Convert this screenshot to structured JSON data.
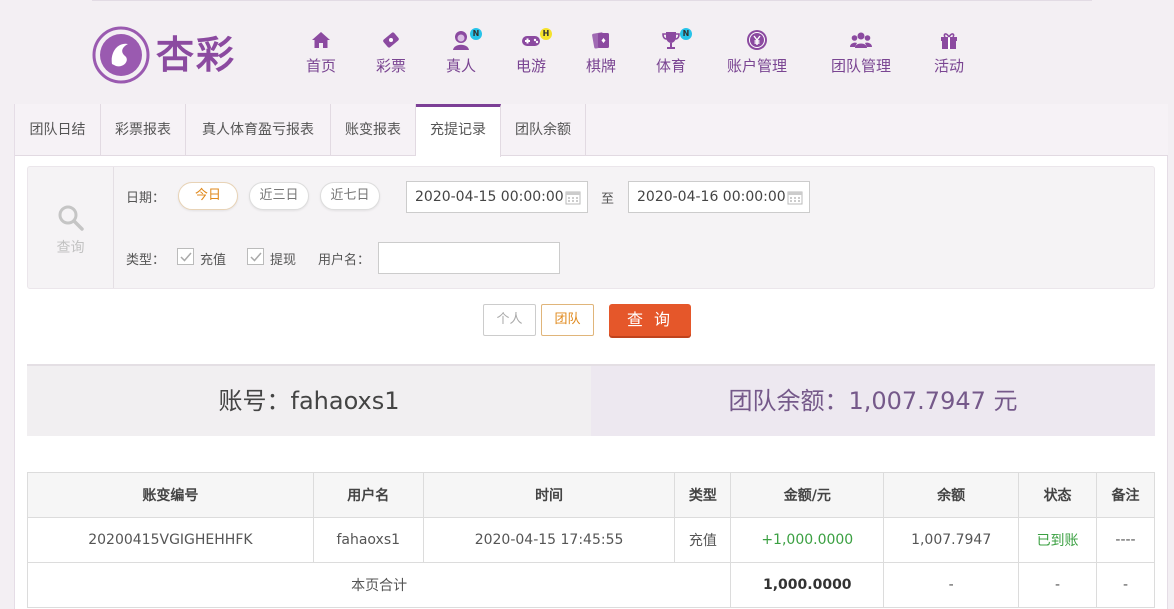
{
  "brand": {
    "logo_text": "杏彩",
    "accent": "#7c3f96"
  },
  "nav": [
    {
      "label": "首页",
      "icon": "home-icon",
      "badge": ""
    },
    {
      "label": "彩票",
      "icon": "lottery-ticket-icon",
      "badge": ""
    },
    {
      "label": "真人",
      "icon": "live-dealer-icon",
      "badge": "N"
    },
    {
      "label": "电游",
      "icon": "gamepad-icon",
      "badge": "H"
    },
    {
      "label": "棋牌",
      "icon": "cards-icon",
      "badge": ""
    },
    {
      "label": "体育",
      "icon": "trophy-icon",
      "badge": "N"
    },
    {
      "label": "账户管理",
      "icon": "yen-coin-icon",
      "badge": ""
    },
    {
      "label": "团队管理",
      "icon": "team-icon",
      "badge": ""
    },
    {
      "label": "活动",
      "icon": "gift-icon",
      "badge": ""
    }
  ],
  "tabs": [
    {
      "label": "团队日结"
    },
    {
      "label": "彩票报表"
    },
    {
      "label": "真人体育盈亏报表"
    },
    {
      "label": "账变报表"
    },
    {
      "label": "充提记录",
      "active": true
    },
    {
      "label": "团队余额"
    }
  ],
  "filter": {
    "search_label": "查询",
    "date_label": "日期：",
    "quick_ranges": [
      "今日",
      "近三日",
      "近七日"
    ],
    "selected_range": "今日",
    "start_date": "2020-04-15 00:00:00",
    "to_label": "至",
    "end_date": "2020-04-16 00:00:00",
    "type_label": "类型：",
    "type_recharge": "充值",
    "type_withdraw": "提现",
    "username_label": "用户名：",
    "username_value": ""
  },
  "buttons": {
    "personal": "个人",
    "team": "团队",
    "query": "查 询"
  },
  "summary": {
    "account": "账号：fahaoxs1",
    "balance": "团队余额：1,007.7947 元"
  },
  "table": {
    "headers": [
      "账变编号",
      "用户名",
      "时间",
      "类型",
      "金额/元",
      "余额",
      "状态",
      "备注"
    ],
    "rows": [
      [
        "20200415VGIGHEHHFK",
        "fahaoxs1",
        "2020-04-15 17:45:55",
        "充值",
        "+1,000.0000",
        "1,007.7947",
        "已到账",
        "----"
      ]
    ],
    "total_row": {
      "label": "本页合计",
      "amount": "1,000.0000",
      "balance": "-",
      "status": "-",
      "note": "-"
    }
  }
}
